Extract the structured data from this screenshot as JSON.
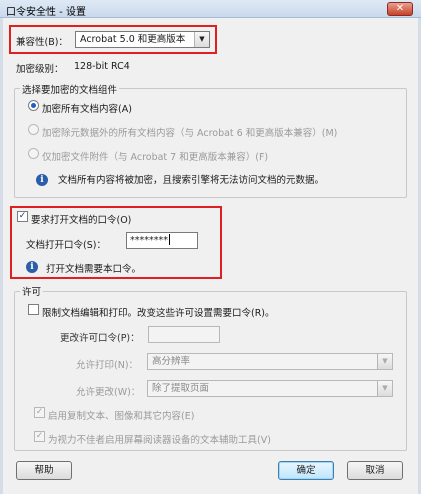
{
  "window": {
    "title": "口令安全性 - 设置",
    "close_label": "✕"
  },
  "compat": {
    "label": "兼容性(B)：",
    "value": "Acrobat 5.0 和更高版本",
    "arrow": "▼"
  },
  "encryption": {
    "label": "加密级别：",
    "value": "128-bit RC4"
  },
  "components_group": {
    "title": "选择要加密的文档组件",
    "options": [
      {
        "label": "加密所有文档内容(A)",
        "selected": true,
        "enabled": true
      },
      {
        "label": "加密除元数据外的所有文档内容（与 Acrobat 6 和更高版本兼容）(M)",
        "selected": false,
        "enabled": false
      },
      {
        "label": "仅加密文件附件（与 Acrobat 7 和更高版本兼容）(F)",
        "selected": false,
        "enabled": false
      }
    ],
    "info": "文档所有内容将被加密，且搜索引擎将无法访问文档的元数据。"
  },
  "open_password": {
    "checkbox_label": "要求打开文档的口令(O)",
    "checked": true,
    "field_label": "文档打开口令(S)：",
    "value": "********",
    "info": "打开文档需要本口令。"
  },
  "permissions_group": {
    "title": "许可",
    "restrict_label": "限制文档编辑和打印。改变这些许可设置需要口令(R)。",
    "restrict_checked": false,
    "change_pw_label": "更改许可口令(P)：",
    "print_label": "允许打印(N)：",
    "print_value": "高分辨率",
    "change_label": "允许更改(W)：",
    "change_value": "除了提取页面",
    "copy_label": "启用复制文本、图像和其它内容(E)",
    "copy_checked": true,
    "access_label": "为视力不佳者启用屏幕阅读器设备的文本辅助工具(V)",
    "access_checked": true
  },
  "buttons": {
    "help": "帮助",
    "ok": "确定",
    "cancel": "取消"
  },
  "icons": {
    "check_mark": "✓",
    "info_mark": "i",
    "dropdown_arrow": "▼"
  },
  "colors": {
    "highlight_red": "#e02020",
    "info_blue": "#2b5ea8"
  }
}
